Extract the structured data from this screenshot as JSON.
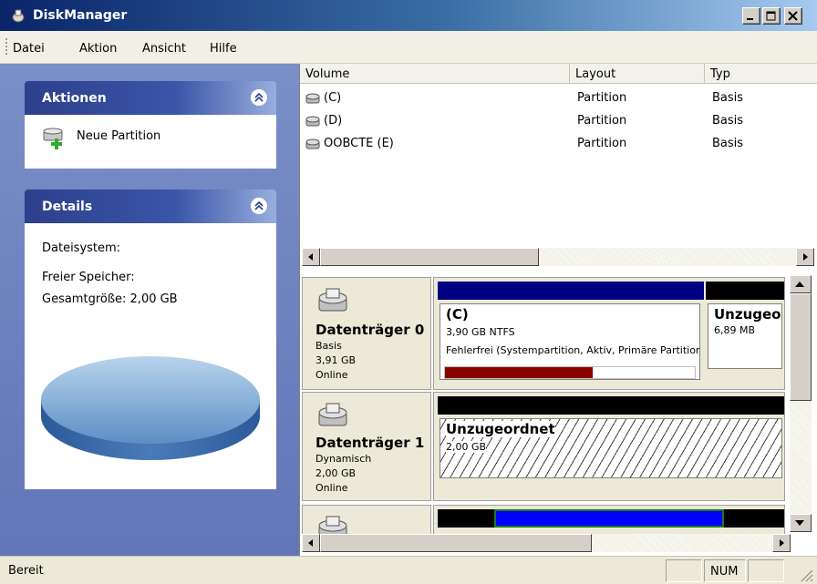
{
  "window": {
    "title": "DiskManager"
  },
  "menu": [
    {
      "label": "Datei"
    },
    {
      "label": "Aktion"
    },
    {
      "label": "Ansicht"
    },
    {
      "label": "Hilfe"
    }
  ],
  "aktionen": {
    "title": "Aktionen",
    "items": [
      {
        "label": "Neue Partition",
        "icon": "new-partition-icon"
      }
    ]
  },
  "details": {
    "title": "Details",
    "filesystem": "Dateisystem:",
    "free": "Freier Speicher:",
    "total": "Gesamtgröße: 2,00 GB"
  },
  "volume_list": {
    "columns": [
      "Volume",
      "Layout",
      "Typ"
    ],
    "rows": [
      {
        "volume": "(C)",
        "layout": "Partition",
        "typ": "Basis"
      },
      {
        "volume": "(D)",
        "layout": "Partition",
        "typ": "Basis"
      },
      {
        "volume": "OOBCTE (E)",
        "layout": "Partition",
        "typ": "Basis"
      }
    ]
  },
  "disks": [
    {
      "name": "Datenträger 0",
      "kind": "Basis",
      "size": "3,91 GB",
      "status": "Online",
      "partitions": [
        {
          "name": "(C)",
          "detail": "3,90 GB NTFS",
          "status": "Fehlerfrei (Systempartition, Aktiv, Primäre Partition)",
          "bar_color": "#000080",
          "usage_fraction": 0.59
        },
        {
          "name": "Unzugeordnet",
          "detail": "6,89 MB",
          "bar_color": "#000000"
        }
      ]
    },
    {
      "name": "Datenträger 1",
      "kind": "Dynamisch",
      "size": "2,00 GB",
      "status": "Online",
      "partitions": [
        {
          "name": "Unzugeordnet",
          "detail": "2,00 GB",
          "bar_color": "#000000"
        }
      ]
    }
  ],
  "status": {
    "text": "Bereit",
    "num": "NUM"
  },
  "colors": {
    "accent": "#0a246a",
    "usage_bar": "#8b0000",
    "volume_bar": "#0000ff"
  }
}
